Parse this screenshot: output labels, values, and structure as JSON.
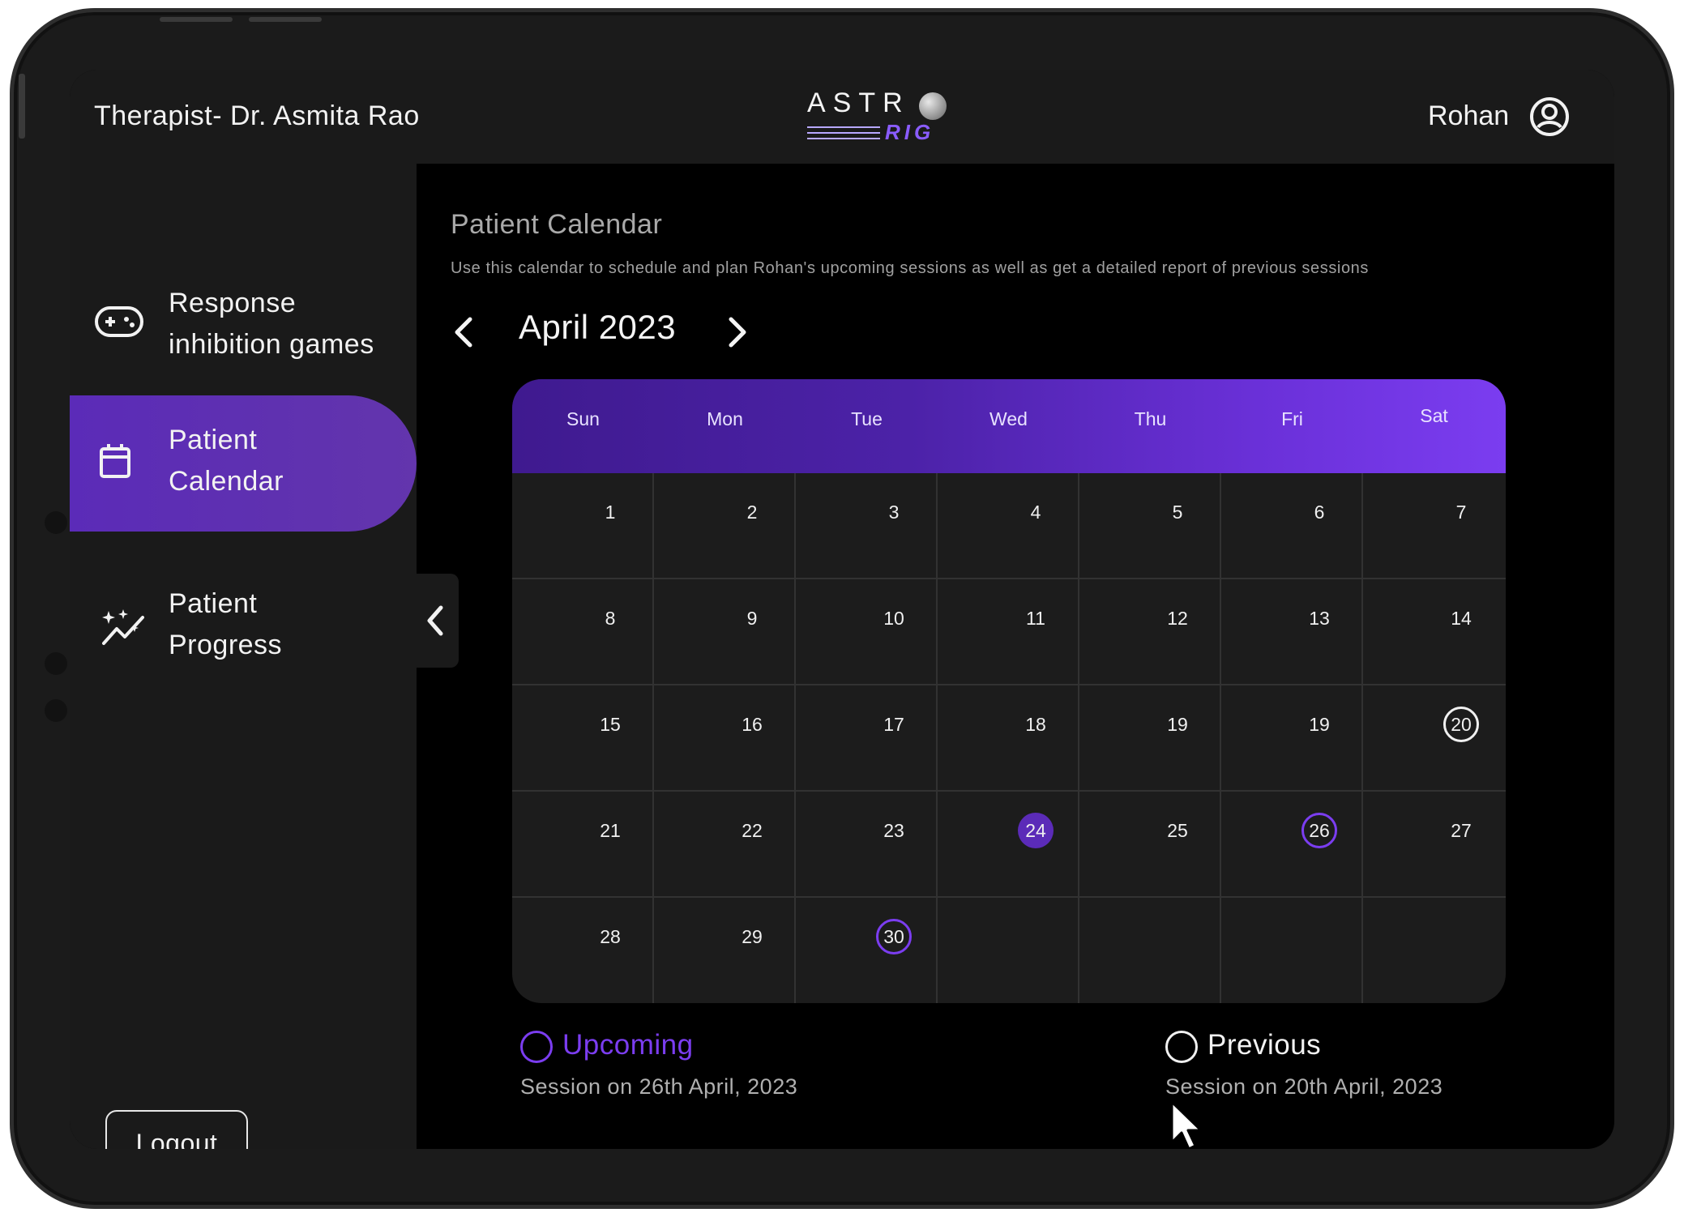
{
  "header": {
    "therapist": "Therapist- Dr. Asmita Rao",
    "logo_top": "ASTR",
    "logo_bottom": "RIG",
    "username": "Rohan",
    "user_icon": "user-circle-icon"
  },
  "sidebar": {
    "items": [
      {
        "line1": "Response",
        "line2": "inhibition games",
        "icon": "gamepad-icon",
        "active": false
      },
      {
        "line1": "Patient",
        "line2": "Calendar",
        "icon": "calendar-icon",
        "active": true
      },
      {
        "line1": "Patient",
        "line2": "Progress",
        "icon": "sparkle-chart-icon",
        "active": false
      }
    ],
    "collapse_icon": "chevron-left-icon",
    "logout_label": "Logout"
  },
  "main": {
    "title": "Patient Calendar",
    "subtitle": "Use this calendar to schedule and plan  Rohan's upcoming sessions as well as get a detailed report of previous sessions",
    "month_label": "April 2023",
    "weekdays": [
      "Sun",
      "Mon",
      "Tue",
      "Wed",
      "Thu",
      "Fri",
      "Sat"
    ],
    "weeks": [
      [
        "1",
        "2",
        "3",
        "4",
        "5",
        "6",
        "7"
      ],
      [
        "8",
        "9",
        "10",
        "11",
        "12",
        "13",
        "14"
      ],
      [
        "15",
        "16",
        "17",
        "18",
        "19",
        "19",
        "20"
      ],
      [
        "21",
        "22",
        "23",
        "24",
        "25",
        "26",
        "27"
      ],
      [
        "28",
        "29",
        "30",
        "",
        "",
        "",
        ""
      ]
    ],
    "marked_days": {
      "previous": [
        "20"
      ],
      "upcoming": [
        "26",
        "30"
      ],
      "selected": [
        "24"
      ]
    },
    "legend": {
      "upcoming_label": "Upcoming",
      "upcoming_session": "Session on 26th April, 2023",
      "previous_label": "Previous",
      "previous_session": "Session on 20th April, 2023"
    }
  },
  "colors": {
    "accent": "#7b3df0",
    "accent_dark": "#5b2bb8",
    "panel": "#1a1a1a",
    "background": "#000000"
  }
}
